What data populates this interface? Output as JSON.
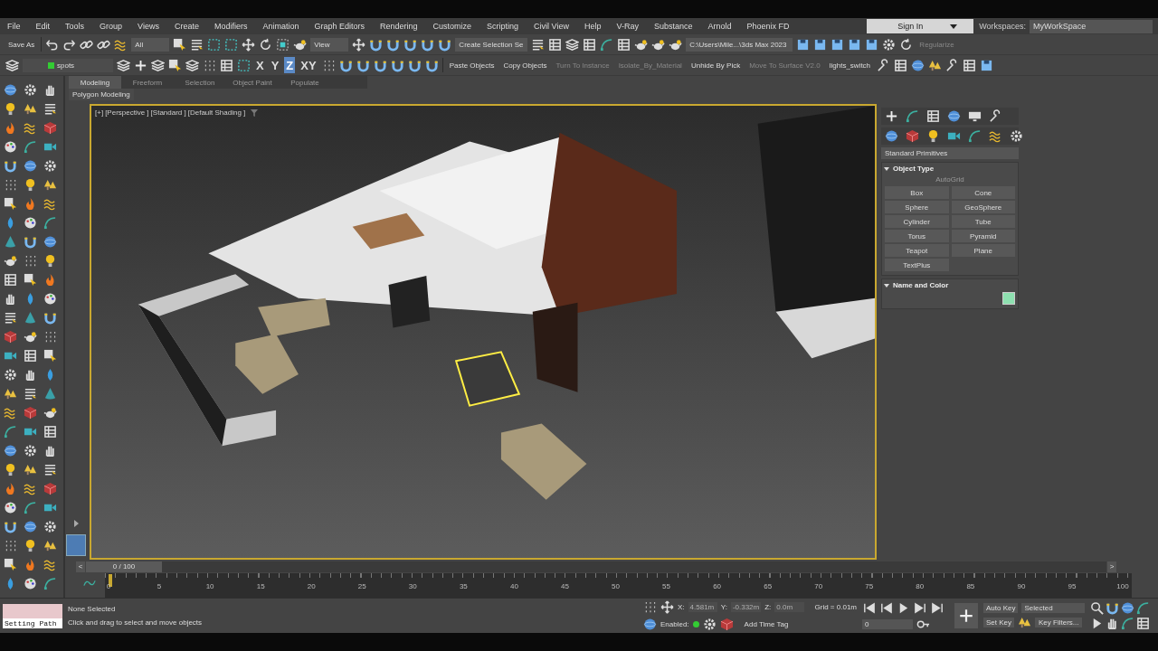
{
  "menu": [
    "File",
    "Edit",
    "Tools",
    "Group",
    "Views",
    "Create",
    "Modifiers",
    "Animation",
    "Graph Editors",
    "Rendering",
    "Customize",
    "Scripting",
    "Civil View",
    "Help",
    "V-Ray",
    "Substance",
    "Arnold",
    "Phoenix FD"
  ],
  "account": {
    "label": "Sign In"
  },
  "workspace": {
    "label": "Workspaces:",
    "value": "MyWorkSpace"
  },
  "main_toolbar": {
    "save_as": "Save As",
    "filter": "All",
    "ref_coord": "View",
    "selection_set": "Create Selection Se",
    "project_path": "C:\\Users\\Mile...\\3ds Max 2023",
    "regularize": {
      "label": "Regularize",
      "disabled": true
    }
  },
  "layer": {
    "value": "spots"
  },
  "axis_buttons": [
    {
      "label": "X",
      "selected": false
    },
    {
      "label": "Y",
      "selected": false
    },
    {
      "label": "Z",
      "selected": true
    },
    {
      "label": "XY",
      "selected": false
    }
  ],
  "scripts": [
    {
      "label": "Paste Objects",
      "disabled": false
    },
    {
      "label": "Copy Objects",
      "disabled": false
    },
    {
      "label": "Turn To Instance",
      "disabled": true
    },
    {
      "label": "Isolate_By_Material",
      "disabled": true
    },
    {
      "label": "Unhide By Pick",
      "disabled": false
    },
    {
      "label": "Move To Surface V2.0",
      "disabled": true
    },
    {
      "label": "lights_switch",
      "disabled": false
    }
  ],
  "ribbon": {
    "tabs": [
      {
        "label": "Modeling",
        "selected": true
      },
      {
        "label": "Freeform",
        "selected": false
      },
      {
        "label": "Selection",
        "selected": false
      },
      {
        "label": "Object Paint",
        "selected": false
      },
      {
        "label": "Populate",
        "selected": false
      }
    ],
    "panel": "Polygon Modeling"
  },
  "viewport": {
    "labels": [
      "[+]",
      "[Perspective ]",
      "[Standard ]",
      "[Default Shading ]"
    ]
  },
  "command_panel": {
    "category": "Standard Primitives",
    "object_type": {
      "title": "Object Type",
      "expanded": true,
      "autogrid": {
        "label": "AutoGrid",
        "disabled": true
      },
      "buttons": [
        "Box",
        "Cone",
        "Sphere",
        "GeoSphere",
        "Cylinder",
        "Tube",
        "Torus",
        "Pyramid",
        "Teapot",
        "Plane",
        "TextPlus"
      ]
    },
    "name_and_color": {
      "title": "Name and Color",
      "expanded": true
    }
  },
  "timeline": {
    "prev": "<",
    "frame": "0 / 100",
    "level": 0,
    "next": ">",
    "ticks": [
      "0",
      "5",
      "10",
      "15",
      "20",
      "25",
      "30",
      "35",
      "40",
      "45",
      "50",
      "55",
      "60",
      "65",
      "70",
      "75",
      "80",
      "85",
      "90",
      "95",
      "100"
    ]
  },
  "status": {
    "script_box": "Setting Path",
    "selection": "None Selected",
    "prompt": "Click and drag to select and move objects",
    "coords": [
      {
        "label": "X:",
        "value": "4.581m"
      },
      {
        "label": "Y:",
        "value": "-0.332m"
      },
      {
        "label": "Z:",
        "value": "0.0m"
      }
    ],
    "grid": "Grid = 0.01m",
    "enabled": "Enabled:",
    "time_tag": "Add Time Tag",
    "current_frame": "0",
    "auto_key": "Auto Key",
    "key_mode": "Selected",
    "set_key": "Set Key",
    "key_filters": "Key Filters..."
  }
}
